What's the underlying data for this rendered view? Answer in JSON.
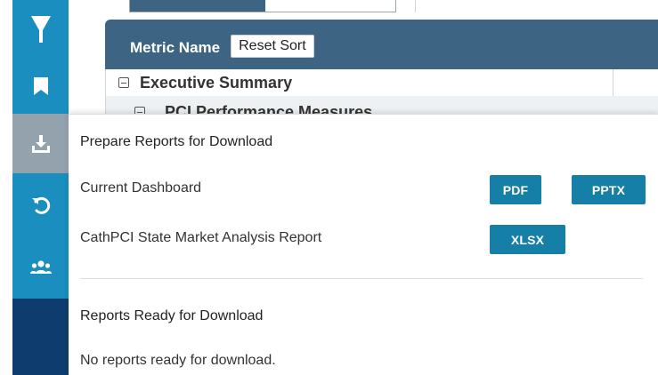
{
  "table": {
    "header_label": "Metric Name",
    "reset_sort_label": "Reset Sort",
    "rows": [
      {
        "label": "Executive Summary"
      },
      {
        "label": "PCI Performance Measures"
      }
    ]
  },
  "sidebar": {
    "items": [
      {
        "icon": "funnel-icon"
      },
      {
        "icon": "bookmark-icon"
      },
      {
        "icon": "download-icon"
      },
      {
        "icon": "undo-icon"
      },
      {
        "icon": "users-group-icon"
      }
    ]
  },
  "download_panel": {
    "title": "Prepare Reports for Download",
    "items": [
      {
        "label": "Current Dashboard",
        "buttons": [
          "PDF",
          "PPTX"
        ]
      },
      {
        "label": "CathPCI State Market Analysis Report",
        "buttons": [
          "XLSX"
        ]
      }
    ],
    "ready_title": "Reports Ready for Download",
    "ready_empty_text": "No reports ready for download."
  },
  "colors": {
    "sidebar_dark": "#0f3c6e",
    "sidebar_accent": "#1a8fbf",
    "sidebar_active": "#93a2ad",
    "table_header": "#3d6483",
    "button_blue": "#157fa8"
  }
}
